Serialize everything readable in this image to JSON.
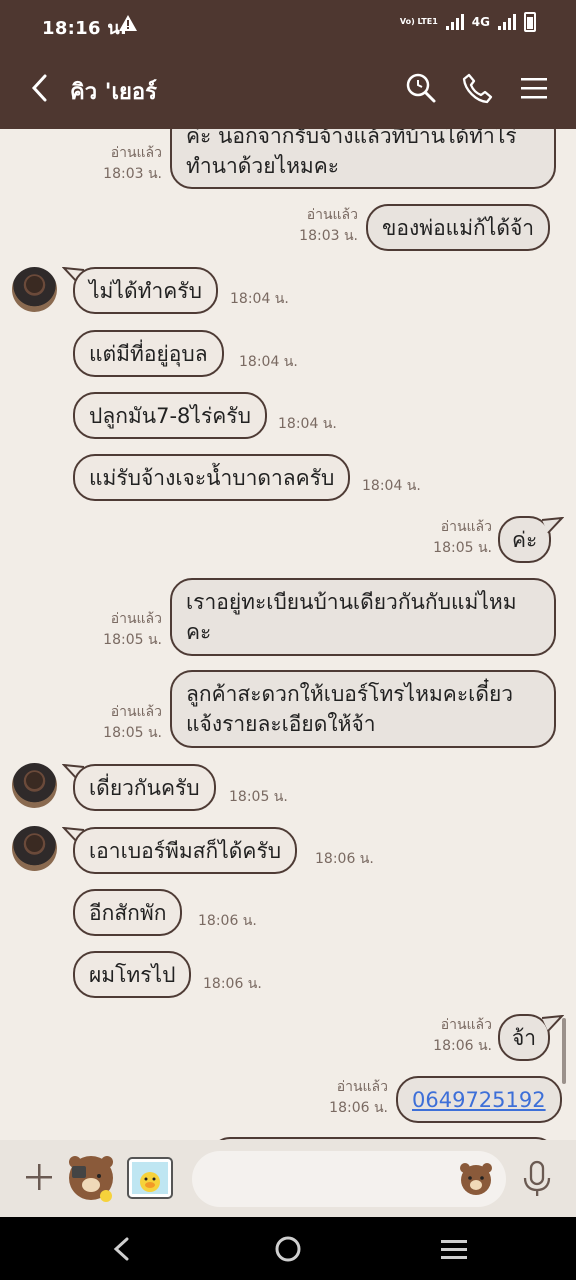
{
  "status_bar": {
    "time": "18:16 น.",
    "network": "4G",
    "volte": "Vo) LTE1"
  },
  "header": {
    "title": "คิว 'เยอร์"
  },
  "messages": [
    {
      "side": "out",
      "lines": [
        "ค่ะ นอกจากรับจ้างแล้วที่บ้านได้ทำไร่",
        "ทำนาด้วยไหมคะ"
      ],
      "read": "อ่านแล้ว",
      "time": "18:03 น."
    },
    {
      "side": "out",
      "text": "ของพ่อแม่ก้ได้จ้า",
      "read": "อ่านแล้ว",
      "time": "18:03 น."
    },
    {
      "side": "in",
      "text": "ไม่ได้ทำครับ",
      "time": "18:04 น."
    },
    {
      "side": "in",
      "text": "แต่มีที่อยู่อุบล",
      "time": "18:04 น."
    },
    {
      "side": "in",
      "text": "ปลูกมัน7-8ไร่ครับ",
      "time": "18:04 น."
    },
    {
      "side": "in",
      "text": "แม่รับจ้างเจะน้ำบาดาลครับ",
      "time": "18:04 น."
    },
    {
      "side": "out",
      "text": "ค่ะ",
      "read": "อ่านแล้ว",
      "time": "18:05 น."
    },
    {
      "side": "out",
      "lines": [
        "เราอยู่ทะเบียนบ้านเดียวกันกับแม่ไหม",
        "คะ"
      ],
      "read": "อ่านแล้ว",
      "time": "18:05 น."
    },
    {
      "side": "out",
      "lines": [
        "ลูกค้าสะดวกให้เบอร์โทรไหมคะเดี๋ยว",
        "แจ้งรายละเอียดให้จ้า"
      ],
      "read": "อ่านแล้ว",
      "time": "18:05 น."
    },
    {
      "side": "in",
      "text": "เดี่ยวกันครับ",
      "time": "18:05 น."
    },
    {
      "side": "in",
      "text": "เอาเบอร์พีมสก็ได้ครับ",
      "time": "18:06 น."
    },
    {
      "side": "in",
      "text": "อีกสักพัก",
      "time": "18:06 น."
    },
    {
      "side": "in",
      "text": "ผมโทรไป",
      "time": "18:06 น."
    },
    {
      "side": "out",
      "text": "จ้า",
      "read": "อ่านแล้ว",
      "time": "18:06 น."
    },
    {
      "side": "out",
      "text": "0649725192",
      "read": "อ่านแล้ว",
      "time": "18:06 น."
    }
  ],
  "input": {
    "placeholder": ""
  },
  "colors": {
    "header_bg": "#4e3730",
    "chat_bg": "#f2ede7",
    "bubble_border": "#4e3b35",
    "link": "#3d6fd8"
  },
  "icons": [
    "back-arrow-icon",
    "search-icon",
    "phone-icon",
    "menu-icon",
    "plus-icon",
    "sticker-brown-icon",
    "sticker-sally-icon",
    "emoji-brown-icon",
    "mic-icon",
    "nav-back-icon",
    "nav-home-icon",
    "nav-recents-icon"
  ]
}
